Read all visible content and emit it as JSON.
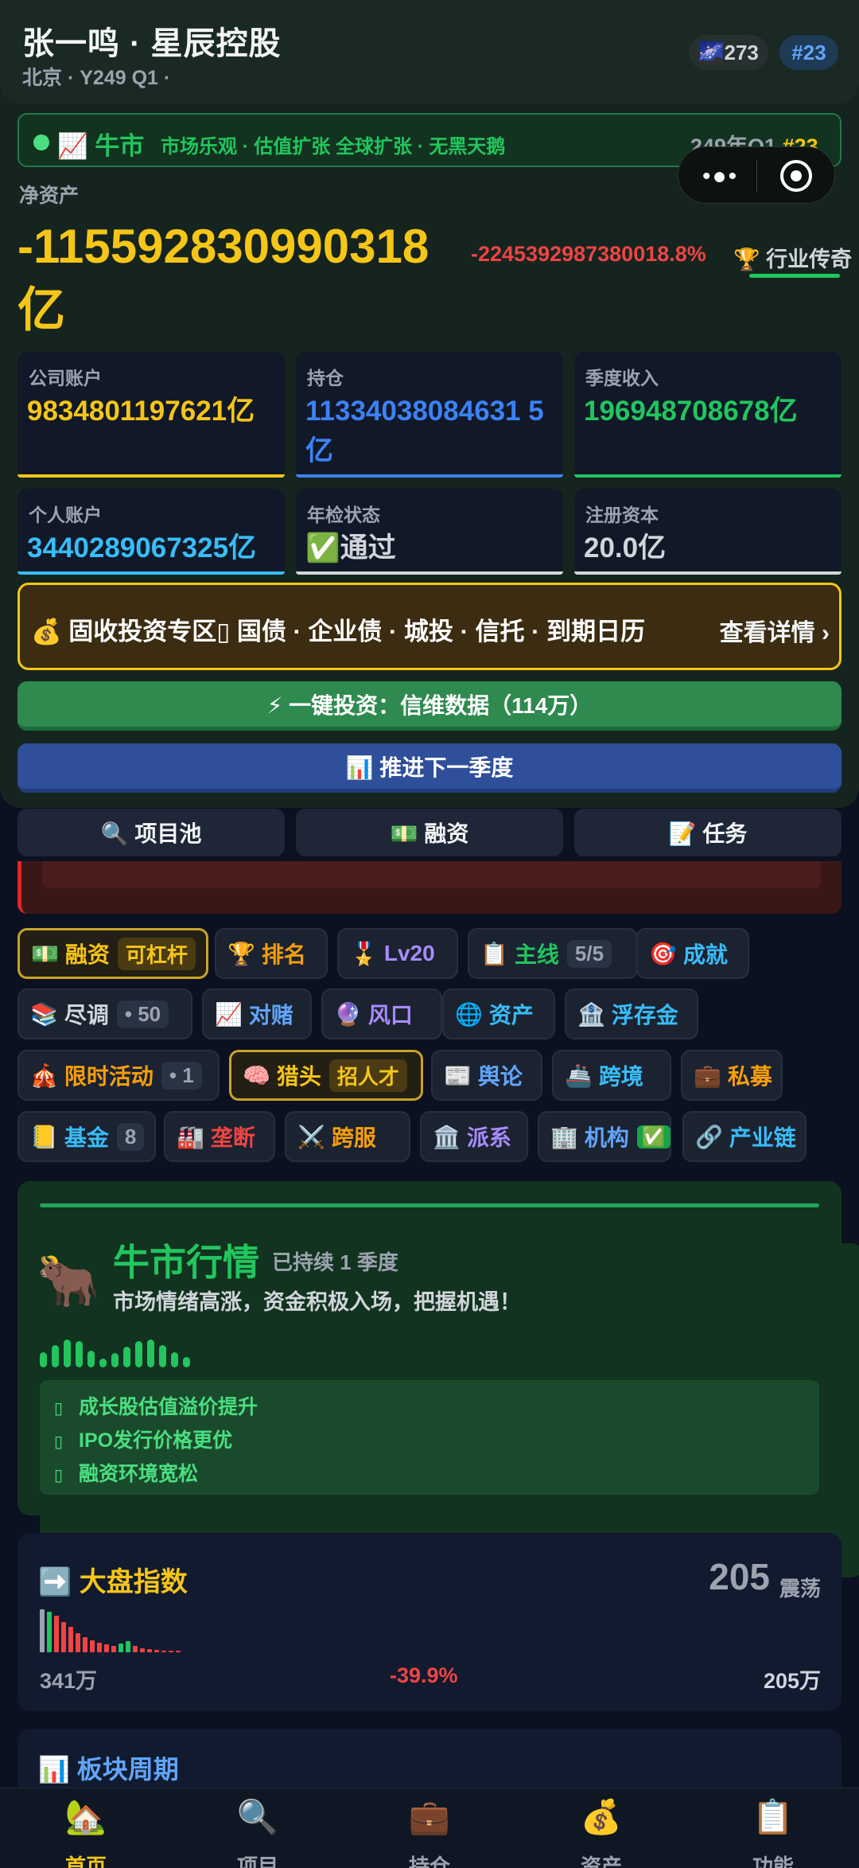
{
  "header": {
    "company": "张一鸣 · 星辰控股",
    "location": "北京",
    "period": "Y249 Q1",
    "market": "📈 牛市",
    "galaxy": "🌌273",
    "rank": "#23"
  },
  "banner": {
    "market": "📈 牛市",
    "desc": "市场乐观 · 估值扩张  全球扩张 · 无黑天鹅",
    "quarter": "249年Q1",
    "rank": "#23"
  },
  "net_assets": {
    "label": "净资产",
    "value": "-115592830990318亿",
    "change": "-2245392987380018.8%",
    "legend": "🏆 行业传奇"
  },
  "cards": [
    {
      "label": "公司账户",
      "value": "9834801197621亿",
      "color": "#f5c518"
    },
    {
      "label": "持仓",
      "value": "11334038084631 5亿",
      "color": "#3b82f6"
    },
    {
      "label": "季度收入",
      "value": "196948708678亿",
      "color": "#22c55e"
    },
    {
      "label": "个人账户",
      "value": "3440289067325亿",
      "color": "#38bdf8"
    },
    {
      "label": "年检状态",
      "value": "✅通过",
      "color": "#d1d5db"
    },
    {
      "label": "注册资本",
      "value": "20.0亿",
      "color": "#d1d5db"
    }
  ],
  "fixed_income": {
    "title": "💰 固收投资专区▯  国债 · 企业债 · 城投 · 信托 · 到期日历",
    "more": "查看详情 ›"
  },
  "actions": {
    "invest": "⚡ 一键投资：信维数据（114万）",
    "next": "📊 推进下一季度"
  },
  "tabs": [
    "🔍 项目池",
    "💵 融资",
    "📝 任务"
  ],
  "chips": [
    {
      "icon": "💵",
      "label": "融资",
      "badge": "可杠杆",
      "gold": true,
      "color": "#f5c518"
    },
    {
      "icon": "🏆",
      "label": "排名",
      "color": "#f59e0b"
    },
    {
      "icon": "🎖️",
      "label": "Lv20",
      "color": "#a78bfa"
    },
    {
      "icon": "📋",
      "label": "主线",
      "count": "5/5",
      "color": "#22c55e"
    },
    {
      "icon": "🎯",
      "label": "成就",
      "color": "#38bdf8"
    },
    {
      "icon": "📚",
      "label": "尽调",
      "count": "• 50",
      "color": "#d1d5db"
    },
    {
      "icon": "📈",
      "label": "对赌",
      "color": "#60a5fa"
    },
    {
      "icon": "🔮",
      "label": "风口",
      "color": "#a78bfa"
    },
    {
      "icon": "🌐",
      "label": "资产",
      "color": "#38bdf8"
    },
    {
      "icon": "🏦",
      "label": "浮存金",
      "color": "#38bdf8"
    },
    {
      "icon": "🎪",
      "label": "限时活动",
      "count": "• 1",
      "color": "#f59e0b"
    },
    {
      "icon": "🧠",
      "label": "猎头",
      "badge": "招人才",
      "gold": true,
      "color": "#f5c518"
    },
    {
      "icon": "📰",
      "label": "舆论",
      "color": "#60a5fa"
    },
    {
      "icon": "🚢",
      "label": "跨境",
      "color": "#38bdf8"
    },
    {
      "icon": "💼",
      "label": "私募",
      "color": "#f59e0b"
    },
    {
      "icon": "📒",
      "label": "基金",
      "count": "8",
      "color": "#38bdf8"
    },
    {
      "icon": "🏭",
      "label": "垄断",
      "color": "#ef4444"
    },
    {
      "icon": "⚔️",
      "label": "跨服",
      "color": "#f59e0b"
    },
    {
      "icon": "🏛️",
      "label": "派系",
      "color": "#a78bfa"
    },
    {
      "icon": "🏢",
      "label": "机构",
      "ok": "✅",
      "color": "#60a5fa"
    },
    {
      "icon": "🔗",
      "label": "产业链",
      "color": "#38bdf8"
    }
  ],
  "bull": {
    "icon": "🐂",
    "title": "牛市行情",
    "duration": "已持续 1 季度",
    "message": "市场情绪高涨，资金积极入场，把握机遇！",
    "bars": [
      0.45,
      0.7,
      0.9,
      0.85,
      0.5,
      0.2,
      0.4,
      0.65,
      0.85,
      0.9,
      0.7,
      0.45,
      0.25
    ],
    "effects": [
      "成长股估值溢价提升",
      "IPO发行价格更优",
      "融资环境宽松"
    ]
  },
  "index": {
    "title": "➡️ 大盘指数",
    "value": "205",
    "state": "震荡",
    "low": "341万",
    "change": "-39.9%",
    "high": "205万",
    "spark": [
      {
        "v": 1.0,
        "c": "#9ca3af"
      },
      {
        "v": 0.95,
        "c": "#22c55e"
      },
      {
        "v": 0.85,
        "c": "#ef4444"
      },
      {
        "v": 0.7,
        "c": "#ef4444"
      },
      {
        "v": 0.6,
        "c": "#ef4444"
      },
      {
        "v": 0.45,
        "c": "#ef4444"
      },
      {
        "v": 0.35,
        "c": "#ef4444"
      },
      {
        "v": 0.28,
        "c": "#ef4444"
      },
      {
        "v": 0.22,
        "c": "#ef4444"
      },
      {
        "v": 0.18,
        "c": "#ef4444"
      },
      {
        "v": 0.15,
        "c": "#ef4444"
      },
      {
        "v": 0.2,
        "c": "#22c55e"
      },
      {
        "v": 0.25,
        "c": "#22c55e"
      },
      {
        "v": 0.14,
        "c": "#ef4444"
      },
      {
        "v": 0.1,
        "c": "#ef4444"
      },
      {
        "v": 0.08,
        "c": "#ef4444"
      },
      {
        "v": 0.05,
        "c": "#ef4444"
      },
      {
        "v": 0.04,
        "c": "#ef4444"
      },
      {
        "v": 0.04,
        "c": "#ef4444"
      },
      {
        "v": 0.04,
        "c": "#ef4444"
      }
    ]
  },
  "sector": {
    "title": "📊 板块周期"
  },
  "nav": [
    {
      "icon": "🏡",
      "label": "首页",
      "active": true
    },
    {
      "icon": "🔍",
      "label": "项目"
    },
    {
      "icon": "💼",
      "label": "持仓"
    },
    {
      "icon": "💰",
      "label": "资产"
    },
    {
      "icon": "📋",
      "label": "功能"
    }
  ]
}
